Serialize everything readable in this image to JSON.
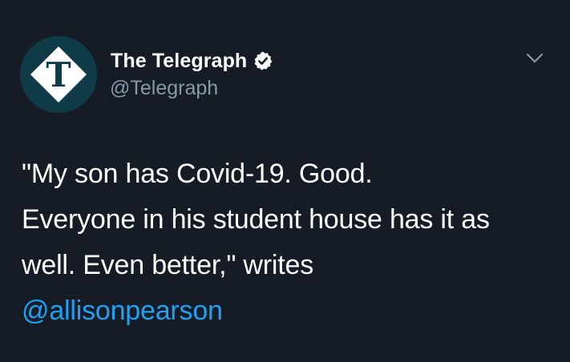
{
  "tweet": {
    "author": {
      "display_name": "The Telegraph",
      "handle": "@Telegraph",
      "verified": true,
      "avatar_icon": "telegraph-t-logo",
      "avatar_glyph": "T"
    },
    "menu_icon": "chevron-down-icon",
    "text_lines": [
      "\"My son has Covid-19. Good.",
      "Everyone in his student house has it as",
      "well. Even better,\" writes"
    ],
    "mention": "@allisonpearson"
  },
  "colors": {
    "background": "#151c26",
    "text": "#ffffff",
    "secondary_text": "#8899a6",
    "link": "#1da1f2",
    "avatar_background": "#0f3a47"
  }
}
